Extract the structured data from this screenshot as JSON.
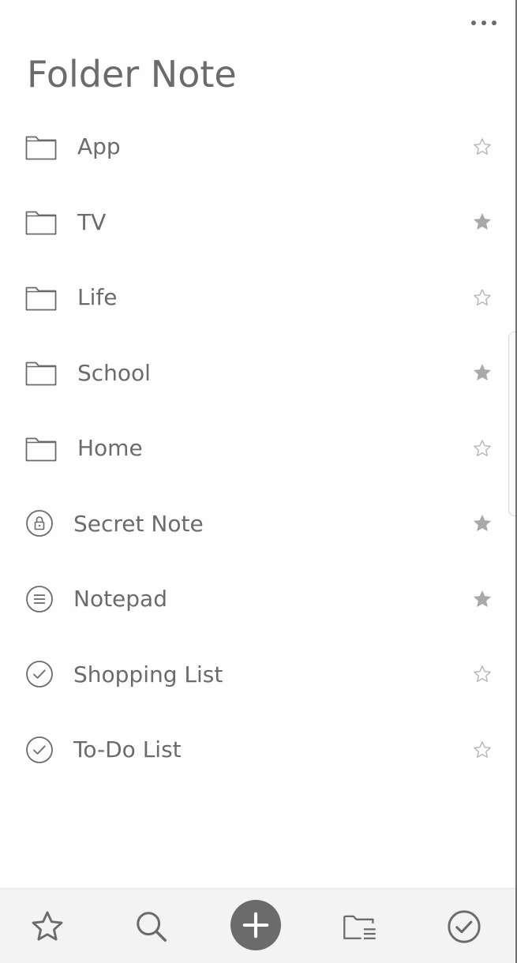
{
  "header": {
    "title": "Folder Note",
    "more_icon": "more-horizontal-icon"
  },
  "items": [
    {
      "label": "App",
      "type": "folder",
      "icon": "folder-icon",
      "starred": false
    },
    {
      "label": "TV",
      "type": "folder",
      "icon": "folder-icon",
      "starred": true
    },
    {
      "label": "Life",
      "type": "folder",
      "icon": "folder-icon",
      "starred": false
    },
    {
      "label": "School",
      "type": "folder",
      "icon": "folder-icon",
      "starred": true
    },
    {
      "label": "Home",
      "type": "folder",
      "icon": "folder-icon",
      "starred": false
    },
    {
      "label": "Secret Note",
      "type": "note",
      "icon": "lock-icon",
      "starred": true
    },
    {
      "label": "Notepad",
      "type": "note",
      "icon": "notepad-icon",
      "starred": true
    },
    {
      "label": "Shopping List",
      "type": "note",
      "icon": "checklist-icon",
      "starred": false
    },
    {
      "label": "To-Do List",
      "type": "note",
      "icon": "checklist-icon",
      "starred": false
    }
  ],
  "bottom_nav": [
    {
      "name": "favorites",
      "icon": "star-icon"
    },
    {
      "name": "search",
      "icon": "search-icon"
    },
    {
      "name": "add",
      "icon": "plus-icon"
    },
    {
      "name": "folders",
      "icon": "folder-list-icon"
    },
    {
      "name": "checklists",
      "icon": "check-circle-icon"
    }
  ],
  "colors": {
    "text": "#6b6b6b",
    "star_filled": "#a9a9a9",
    "star_outline": "#b5b5b5",
    "bottom_bar": "#f3f3f3",
    "add_button": "#6b6b6b"
  }
}
